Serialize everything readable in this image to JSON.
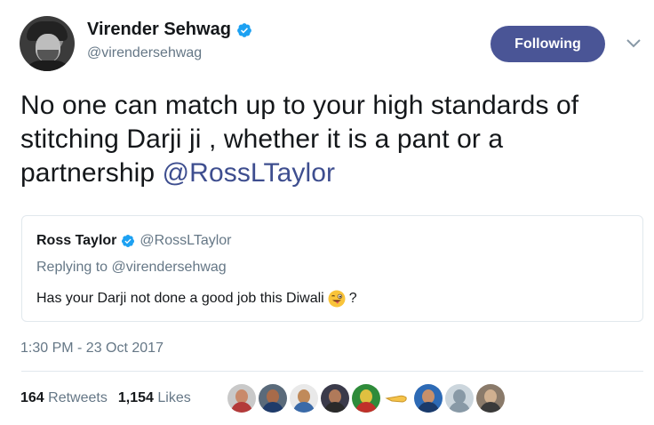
{
  "author": {
    "name": "Virender Sehwag",
    "handle": "@virendersehwag"
  },
  "actions": {
    "follow_label": "Following"
  },
  "tweet": {
    "text": "No one can match up to your high standards of stitching Darji ji , whether it is a pant or a partnership ",
    "mention": "@RossLTaylor"
  },
  "quoted": {
    "name": "Ross Taylor",
    "handle": "@RossLTaylor",
    "replying_to": "Replying to @virendersehwag",
    "text": "Has your Darji not done a good job this Diwali",
    "text_suffix": "?"
  },
  "meta": {
    "timestamp": "1:30 PM - 23 Oct 2017"
  },
  "stats": {
    "retweets_count": "164",
    "retweets_label": "Retweets",
    "likes_count": "1,154",
    "likes_label": "Likes"
  },
  "colors": {
    "follow_bg": "#4a5596",
    "verified": "#1da1f2",
    "mention": "#3e4e8f",
    "muted": "#657786"
  },
  "likers": [
    {
      "icon": "user-avatar-1"
    },
    {
      "icon": "user-avatar-2"
    },
    {
      "icon": "user-avatar-3"
    },
    {
      "icon": "user-avatar-4"
    },
    {
      "icon": "user-avatar-5"
    },
    {
      "icon": "user-avatar-6"
    },
    {
      "icon": "user-avatar-7"
    },
    {
      "icon": "default-avatar"
    },
    {
      "icon": "user-avatar-9"
    }
  ]
}
